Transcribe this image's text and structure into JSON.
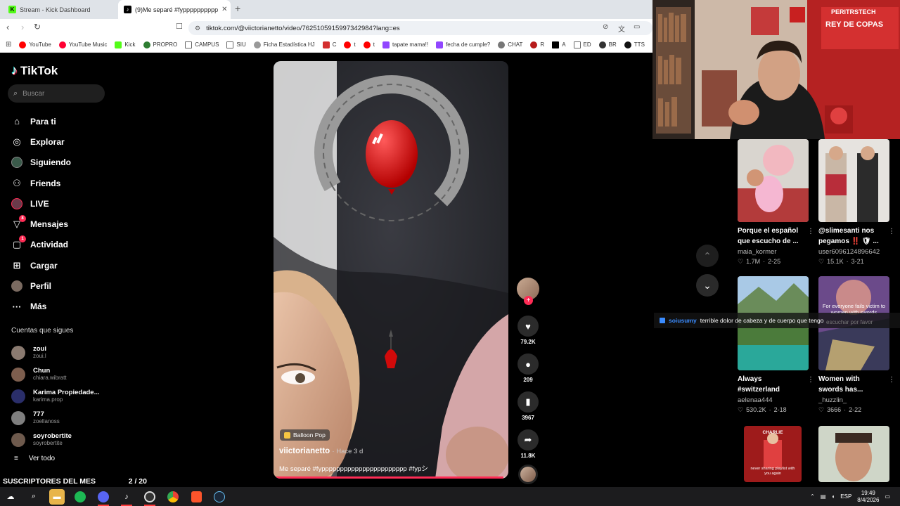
{
  "browser": {
    "tabs": [
      {
        "title": "Stream - Kick Dashboard",
        "active": false
      },
      {
        "title": "(9)Me separé #fypppppppppp",
        "active": true
      }
    ],
    "new_tab": "+",
    "url": "tiktok.com/@viictorianetto/video/7625105915997342984?lang=es",
    "bookmarks": [
      "YouTube",
      "YouTube Music",
      "Kick",
      "PROPRO",
      "CAMPUS",
      "SIU",
      "Ficha Estadística HJ",
      "C",
      "t",
      "t",
      "tapate mama!!",
      "fecha de cumple?",
      "CHAT",
      "R",
      "A",
      "ED",
      "BR",
      "TTS"
    ]
  },
  "sidebar": {
    "logo": "TikTok",
    "search_placeholder": "Buscar",
    "nav": [
      {
        "label": "Para ti",
        "icon": "home-icon"
      },
      {
        "label": "Explorar",
        "icon": "compass-icon"
      },
      {
        "label": "Siguiendo",
        "icon": "following-icon"
      },
      {
        "label": "Friends",
        "icon": "friends-icon"
      },
      {
        "label": "LIVE",
        "icon": "live-icon"
      },
      {
        "label": "Mensajes",
        "icon": "messages-icon",
        "badge": "8"
      },
      {
        "label": "Actividad",
        "icon": "activity-icon",
        "badge": "1"
      },
      {
        "label": "Cargar",
        "icon": "upload-icon"
      },
      {
        "label": "Perfil",
        "icon": "profile-icon"
      },
      {
        "label": "Más",
        "icon": "more-icon"
      }
    ],
    "following_header": "Cuentas que sigues",
    "following": [
      {
        "name": "zoui",
        "handle": "zoui.l",
        "color": "#8a7a70"
      },
      {
        "name": "Chun",
        "handle": "chiara.wibratt",
        "color": "#7d5e4e"
      },
      {
        "name": "Karima Propiedade...",
        "handle": "karima.prop",
        "color": "#2a2e6a"
      },
      {
        "name": "777",
        "handle": "zoellanoss",
        "color": "#7f7f7f"
      },
      {
        "name": "soyrobertite",
        "handle": "soyrobertite",
        "color": "#6e5a4d"
      }
    ],
    "see_all": "Ver todo"
  },
  "overlay_bottom": {
    "label": "SUSCRIPTORES DEL MES",
    "count": "2 / 20"
  },
  "video": {
    "tag": "Balloon Pop",
    "username": "viictorianetto",
    "time_ago": "· Hace 3 d",
    "description": "Me separé #fyppppppppppppppppppppppp #fypシ",
    "progress": 0.98
  },
  "actions": {
    "likes": "79.2K",
    "comments": "209",
    "saves": "3967",
    "shares": "11.8K"
  },
  "related": [
    {
      "title_lines": [
        "Porque el español",
        "que escucho de ..."
      ],
      "user": "maia_kormer",
      "likes": "1.7M",
      "date": "2-25"
    },
    {
      "title_lines": [
        "@slimesanti nos",
        "pegamos ‼️ 🛡 ..."
      ],
      "user": "user6096124896642",
      "likes": "15.1K",
      "date": "3-21"
    },
    {
      "title_lines": [
        "Always",
        "#switzerland"
      ],
      "user": "aelenaa444",
      "likes": "530.2K",
      "date": "2-18"
    },
    {
      "title_lines": [
        "Women with",
        "swords has..."
      ],
      "user": "_huzzlin_",
      "likes": "3666",
      "date": "2-22"
    }
  ],
  "related_thumb_texts": {
    "t4": "For everyone fails victim to women with swords",
    "t5a": "CHARLIE",
    "t5b": "never sharing playlist with",
    "t5c": "you again"
  },
  "chat": {
    "user": "soiusumy",
    "message": "terrible dolor de cabeza y de cuerpo que tengo",
    "faded": "escuchar por favor"
  },
  "taskbar": {
    "lang": "ESP",
    "time": "19:49",
    "date": "8/4/2026"
  },
  "colors": {
    "accent": "#fe2c55",
    "kick": "#53fc18"
  }
}
